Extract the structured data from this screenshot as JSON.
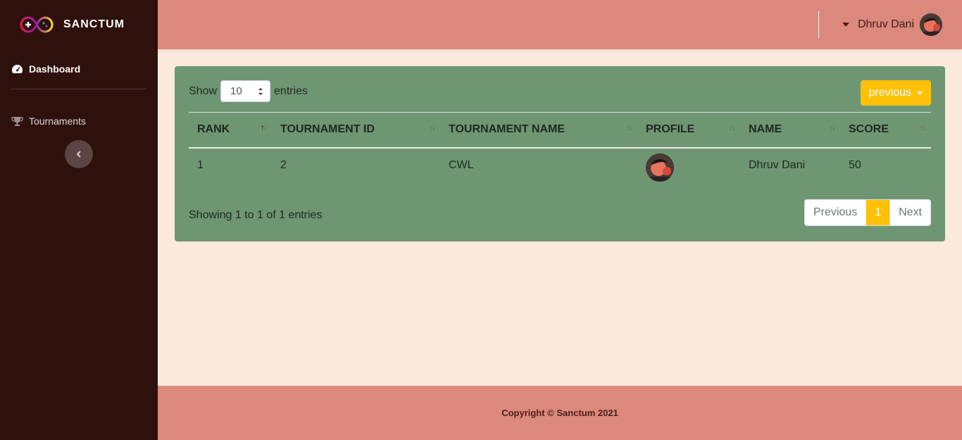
{
  "brand": {
    "name": "SANCTUM"
  },
  "sidebar": {
    "items": [
      {
        "label": "Dashboard",
        "icon": "dashboard-icon"
      },
      {
        "label": "Tournaments",
        "icon": "trophy-icon"
      }
    ],
    "toggle_icon": "chevron-left-icon"
  },
  "topbar": {
    "user_name": "Dhruv Dani"
  },
  "table_controls": {
    "show_label": "Show",
    "entries_value": "10",
    "entries_label": "entries",
    "previous_button": "previous"
  },
  "table": {
    "headers": [
      "RANK",
      "TOURNAMENT ID",
      "TOURNAMENT NAME",
      "PROFILE",
      "NAME",
      "SCORE"
    ],
    "rows": [
      {
        "rank": "1",
        "tournament_id": "2",
        "tournament_name": "CWL",
        "name": "Dhruv Dani",
        "score": "50"
      }
    ]
  },
  "table_info": "Showing 1 to 1 of 1 entries",
  "pagination": {
    "previous": "Previous",
    "current": "1",
    "next": "Next"
  },
  "footer": {
    "copyright": "Copyright © Sanctum 2021"
  },
  "colors": {
    "sidebar_bg": "#2e100d",
    "topbar_bg": "#db897d",
    "card_bg": "#6f9673",
    "accent": "#ffc107",
    "page_bg": "#fbeadb"
  }
}
